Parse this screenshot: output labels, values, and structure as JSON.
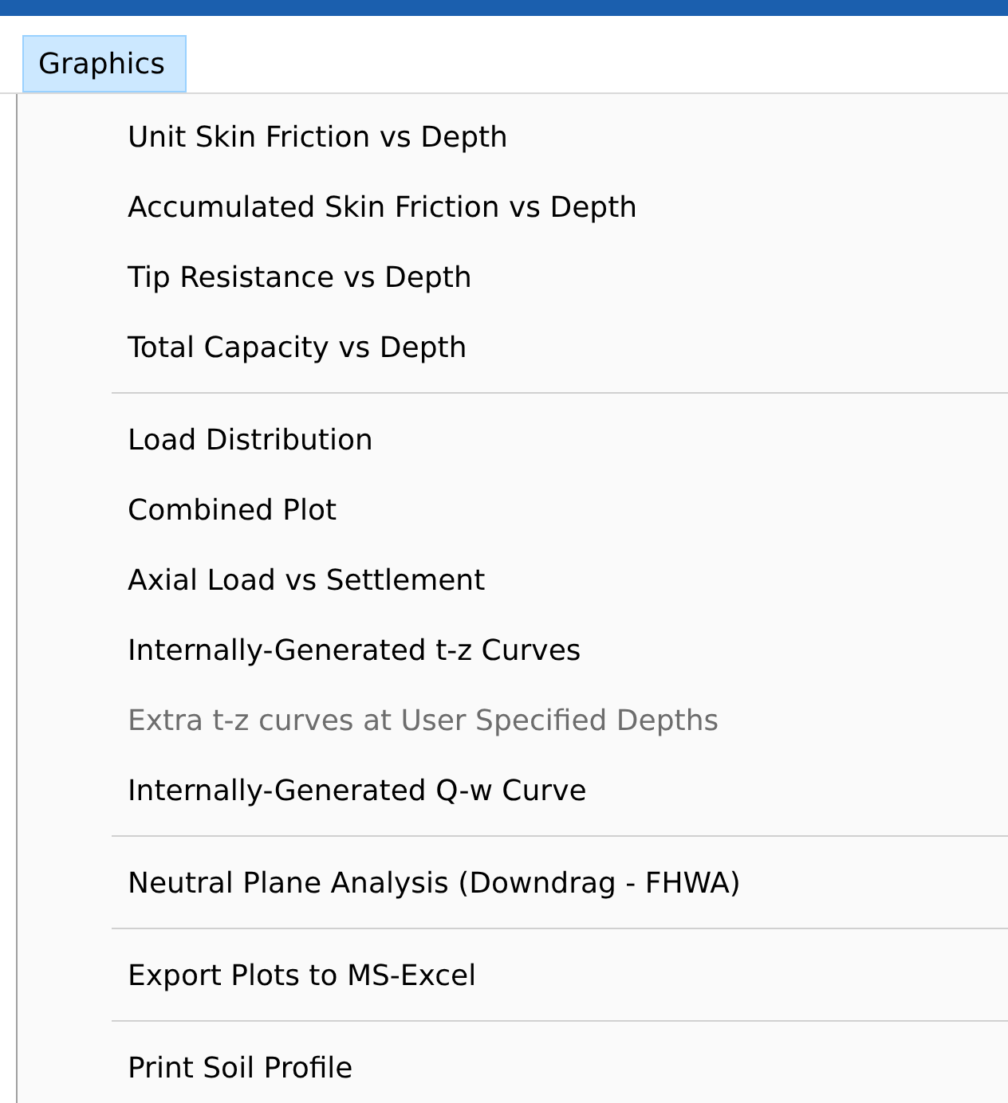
{
  "menu_bar": [
    {
      "label": "Graphics",
      "selected": true
    }
  ],
  "menu": {
    "groups": [
      [
        {
          "label": "Unit Skin Friction vs Depth",
          "disabled": false
        },
        {
          "label": "Accumulated Skin Friction vs Depth",
          "disabled": false
        },
        {
          "label": "Tip Resistance vs Depth",
          "disabled": false
        },
        {
          "label": "Total Capacity vs Depth",
          "disabled": false
        }
      ],
      [
        {
          "label": "Load Distribution",
          "disabled": false
        },
        {
          "label": "Combined Plot",
          "disabled": false
        },
        {
          "label": "Axial Load vs Settlement",
          "disabled": false
        },
        {
          "label": "Internally-Generated t-z Curves",
          "disabled": false
        },
        {
          "label": "Extra t-z curves at User Specified Depths",
          "disabled": true
        },
        {
          "label": "Internally-Generated Q-w Curve",
          "disabled": false
        }
      ],
      [
        {
          "label": "Neutral Plane Analysis (Downdrag - FHWA)",
          "disabled": false
        }
      ],
      [
        {
          "label": "Export Plots to MS-Excel",
          "disabled": false
        }
      ],
      [
        {
          "label": "Print Soil Profile",
          "disabled": false
        }
      ]
    ]
  }
}
